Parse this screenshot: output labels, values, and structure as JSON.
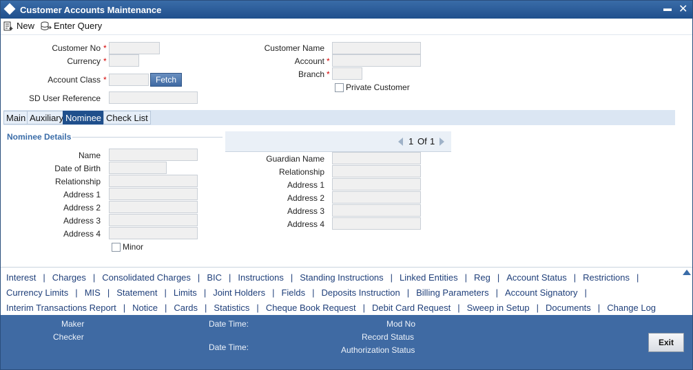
{
  "window": {
    "title": "Customer Accounts Maintenance",
    "minimize": "▬",
    "close": "✕"
  },
  "toolbar": {
    "new_label": "New",
    "enter_query_label": "Enter Query"
  },
  "header_form": {
    "customer_no": "Customer No",
    "currency": "Currency",
    "account_class": "Account Class",
    "fetch": "Fetch",
    "sd_user_reference": "SD User Reference",
    "customer_name": "Customer Name",
    "account": "Account",
    "branch": "Branch",
    "private_customer": "Private Customer",
    "required_mark": "*"
  },
  "tabs": [
    {
      "label": "Main"
    },
    {
      "label": "Auxiliary"
    },
    {
      "label": "Nominee"
    },
    {
      "label": "Check List"
    }
  ],
  "nominee": {
    "section_title": "Nominee Details",
    "name": "Name",
    "date_of_birth": "Date of Birth",
    "relationship": "Relationship",
    "address1": "Address 1",
    "address2": "Address 2",
    "address3": "Address 3",
    "address4": "Address 4",
    "minor": "Minor",
    "pager_current": "1",
    "pager_of": "Of",
    "pager_total": "1",
    "guardian_name": "Guardian Name",
    "g_relationship": "Relationship",
    "g_address1": "Address 1",
    "g_address2": "Address 2",
    "g_address3": "Address 3",
    "g_address4": "Address 4"
  },
  "links": {
    "row1": [
      "Interest",
      "Charges",
      "Consolidated Charges",
      "BIC",
      "Instructions",
      "Standing Instructions",
      "Linked Entities",
      "Reg",
      "Account Status",
      "Restrictions"
    ],
    "row2": [
      "Currency Limits",
      "MIS",
      "Statement",
      "Limits",
      "Joint Holders",
      "Fields",
      "Deposits Instruction",
      "Billing Parameters",
      "Account Signatory"
    ],
    "row3": [
      "Interim Transactions Report",
      "Notice",
      "Cards",
      "Statistics",
      "Cheque Book Request",
      "Debit Card Request",
      "Sweep in Setup",
      "Documents",
      "Change Log"
    ]
  },
  "footer": {
    "maker": "Maker",
    "checker": "Checker",
    "date_time_1": "Date Time:",
    "date_time_2": "Date Time:",
    "mod_no": "Mod No",
    "record_status": "Record Status",
    "authorization_status": "Authorization Status",
    "exit": "Exit"
  },
  "colors": {
    "title_bar": "#1f4f8c",
    "active_tab": "#1f4f8c",
    "footer": "#3f6aa3",
    "required": "#d40000"
  },
  "icons": {
    "app": "diamond-icon",
    "new": "new-document-icon",
    "enter_query": "database-query-icon",
    "pager_prev": "triangle-left-icon",
    "pager_next": "triangle-right-icon",
    "scroll_up": "triangle-up-icon"
  }
}
